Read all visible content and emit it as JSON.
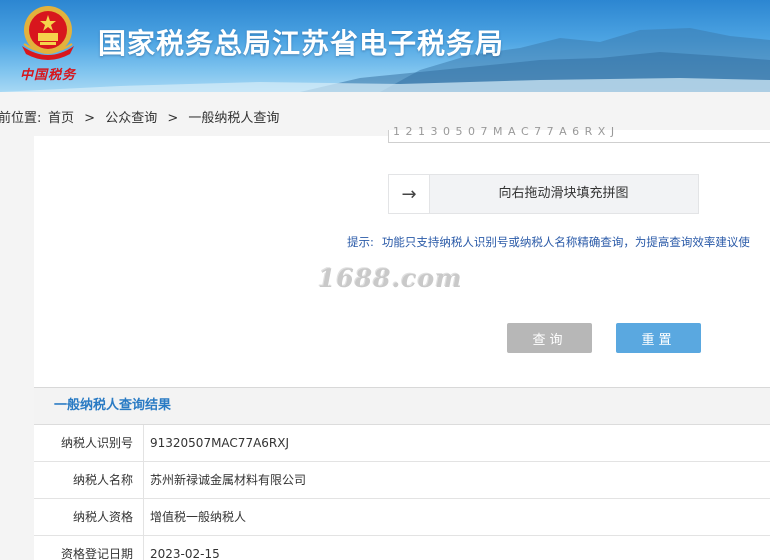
{
  "header": {
    "site_title": "国家税务总局江苏省电子税务局",
    "brand_script": "中国税务"
  },
  "breadcrumb": {
    "prefix": "前位置:",
    "items": [
      "首页",
      "公众查询",
      "一般纳税人查询"
    ],
    "separator": ">"
  },
  "form": {
    "previous_input_value": "1 2 1 3 0 5 0 7 M A C 7 7 A 6 R X J",
    "slider_handle_icon": "arrow-right-icon",
    "slider_handle_glyph": "→",
    "slider_text": "向右拖动滑块填充拼图",
    "hint_label": "提示:",
    "hint_text": "功能只支持纳税人识别号或纳税人名称精确查询，为提高查询效率建议使",
    "watermark": "1688.com",
    "query_button": "查询",
    "reset_button": "重置"
  },
  "results": {
    "title": "一般纳税人查询结果",
    "rows": [
      {
        "label": "纳税人识别号",
        "value": "91320507MAC77A6RXJ"
      },
      {
        "label": "纳税人名称",
        "value": "苏州新禄诚金属材料有限公司"
      },
      {
        "label": "纳税人资格",
        "value": "增值税一般纳税人"
      },
      {
        "label": "资格登记日期",
        "value": "2023-02-15"
      }
    ]
  },
  "colors": {
    "header_blue": "#2c86d1",
    "link_blue": "#2a7bc4",
    "hint_blue": "#2a5aa8",
    "reset_button": "#5aa8e0",
    "query_button": "#b7b7b7",
    "emblem_red": "#d8161d",
    "emblem_gold": "#e3b23c"
  }
}
